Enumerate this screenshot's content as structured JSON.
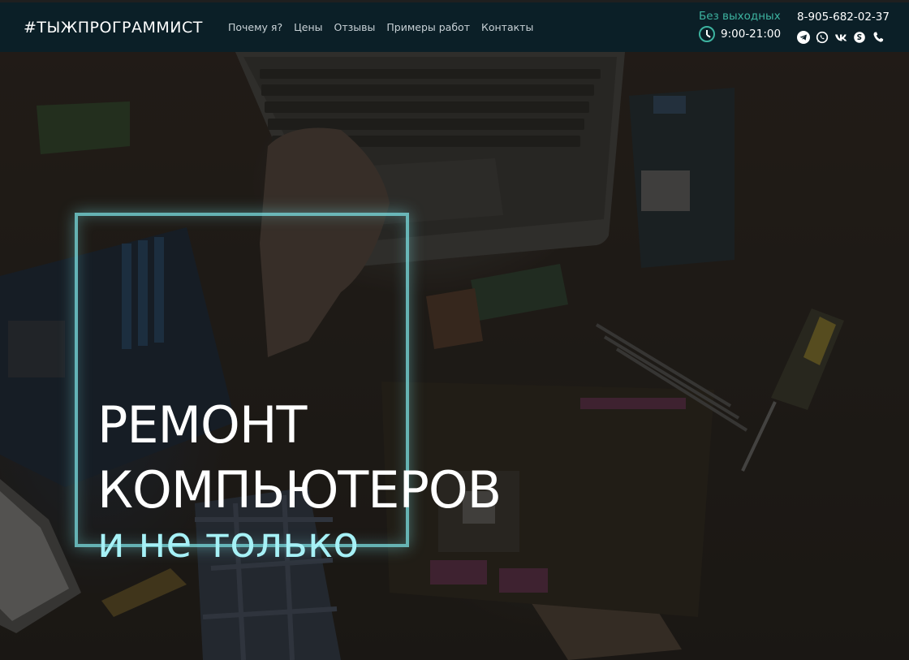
{
  "header": {
    "logo": "#ТЫЖПРОГРАММИСТ",
    "nav": [
      "Почему я?",
      "Цены",
      "Отзывы",
      "Примеры работ",
      "Контакты"
    ],
    "schedule_days": "Без выходных",
    "schedule_hours": "9:00-21:00",
    "phone": "8-905-682-02-37",
    "socials": [
      "telegram-icon",
      "whatsapp-icon",
      "vk-icon",
      "skype-icon",
      "phone-icon"
    ]
  },
  "hero": {
    "line1": "РЕМОНТ",
    "line2": "КОМПЬЮТЕРОВ",
    "line3": "и не только"
  },
  "colors": {
    "accent": "#3db3a0",
    "accent_light": "#a6f1f6",
    "topbar": "#0b1f27"
  }
}
